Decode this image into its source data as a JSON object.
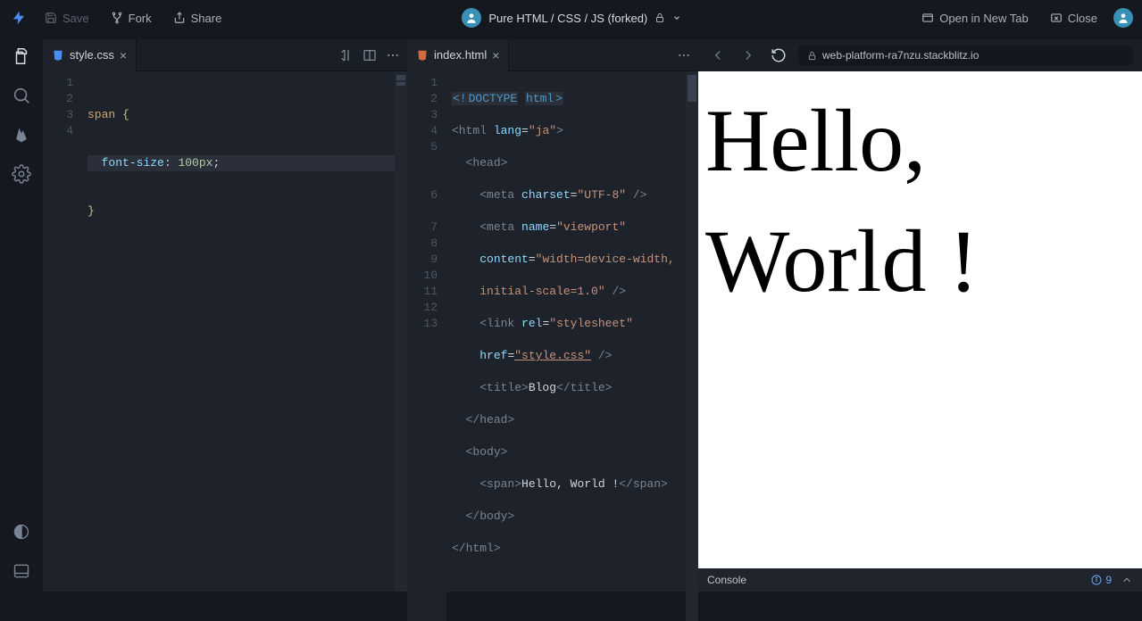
{
  "topbar": {
    "save": "Save",
    "fork": "Fork",
    "share": "Share",
    "project_title": "Pure HTML / CSS / JS (forked)",
    "open_new_tab": "Open in New Tab",
    "close": "Close"
  },
  "editor_left": {
    "tab_label": "style.css",
    "lines": [
      "1",
      "2",
      "3",
      "4"
    ],
    "code": {
      "l1_selector": "span",
      "l1_brace": "{",
      "l2_prop": "font-size",
      "l2_colon": ":",
      "l2_value": "100px",
      "l2_semi": ";",
      "l3_brace": "}"
    }
  },
  "editor_right": {
    "tab_label": "index.html",
    "lines": [
      "1",
      "2",
      "3",
      "4",
      "5",
      "6",
      "7",
      "8",
      "9",
      "10",
      "11",
      "12",
      "13"
    ],
    "code": {
      "doctype_open": "<!",
      "doctype_word": "DOCTYPE",
      "doctype_html": "html",
      "doctype_close": ">",
      "html_open": "<html",
      "lang_attr": "lang",
      "lang_val": "\"ja\"",
      "gt": ">",
      "head_open": "<head>",
      "meta1": "<meta",
      "charset_attr": "charset",
      "charset_val": "\"UTF-8\"",
      "selfclose": " />",
      "meta2": "<meta",
      "name_attr": "name",
      "viewport_val": "\"viewport\"",
      "content_attr": "content",
      "content_val": "\"width=device-width, initial-scale=1.0\"",
      "link": "<link",
      "rel_attr": "rel",
      "rel_val": "\"stylesheet\"",
      "href_attr": "href",
      "href_val": "\"style.css\"",
      "title_open": "<title>",
      "title_text": "Blog",
      "title_close": "</title>",
      "head_close": "</head>",
      "body_open": "<body>",
      "span_open": "<span>",
      "hello": "Hello, World !",
      "span_close": "</span>",
      "body_close": "</body>",
      "html_close": "</html>"
    }
  },
  "preview": {
    "url": "web-platform-ra7nzu.stackblitz.io",
    "content": "Hello, World !"
  },
  "console": {
    "label": "Console",
    "count": "9"
  }
}
